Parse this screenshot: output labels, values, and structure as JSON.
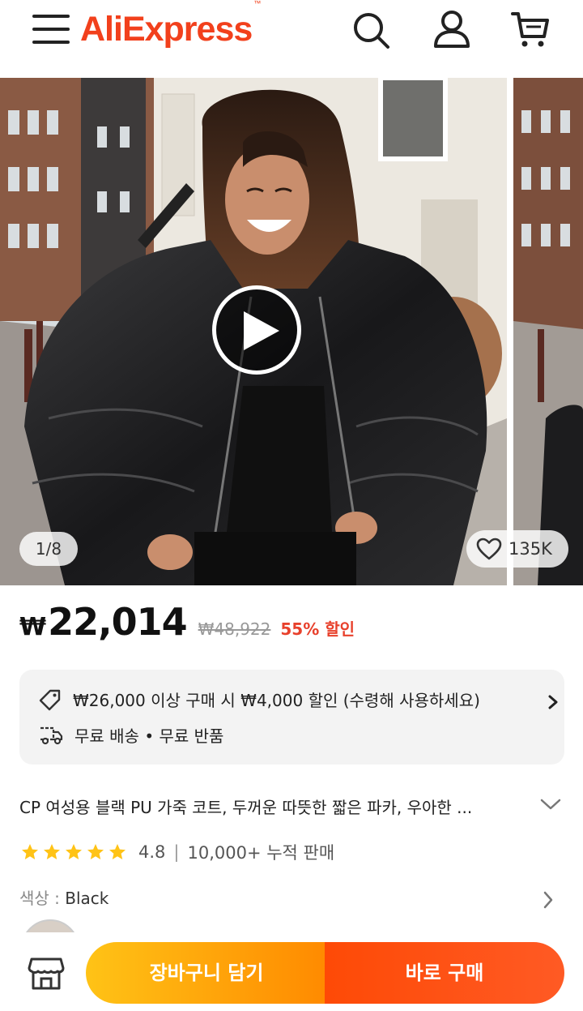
{
  "header": {
    "logo_text": "AliExpress",
    "logo_tm": "™",
    "icons": [
      "menu-icon",
      "search-icon",
      "account-icon",
      "cart-icon"
    ],
    "brand_color": "#f2401c"
  },
  "gallery": {
    "counter": "1/8",
    "wishlist_count": "135K"
  },
  "price": {
    "currency": "₩",
    "current": "22,014",
    "original": "₩48,922",
    "discount": "55% 할인",
    "discount_color": "#e8412c"
  },
  "promo": {
    "coupon_text": "₩26,000 이상 구매 시 ₩4,000 할인 (수령해 사용하세요)",
    "shipping_text": "무료 배송 • 무료 반품"
  },
  "product": {
    "title": "CP 여성용 블랙 PU 가죽 코트, 두꺼운 따뜻한 짧은 파카, 우아한 ...",
    "rating": "4.8",
    "stars": 5,
    "sold": "10,000+ 누적 판매",
    "color_label": "색상 : ",
    "color_value": "Black"
  },
  "actions": {
    "add_to_cart": "장바구니 담기",
    "buy_now": "바로 구매"
  }
}
